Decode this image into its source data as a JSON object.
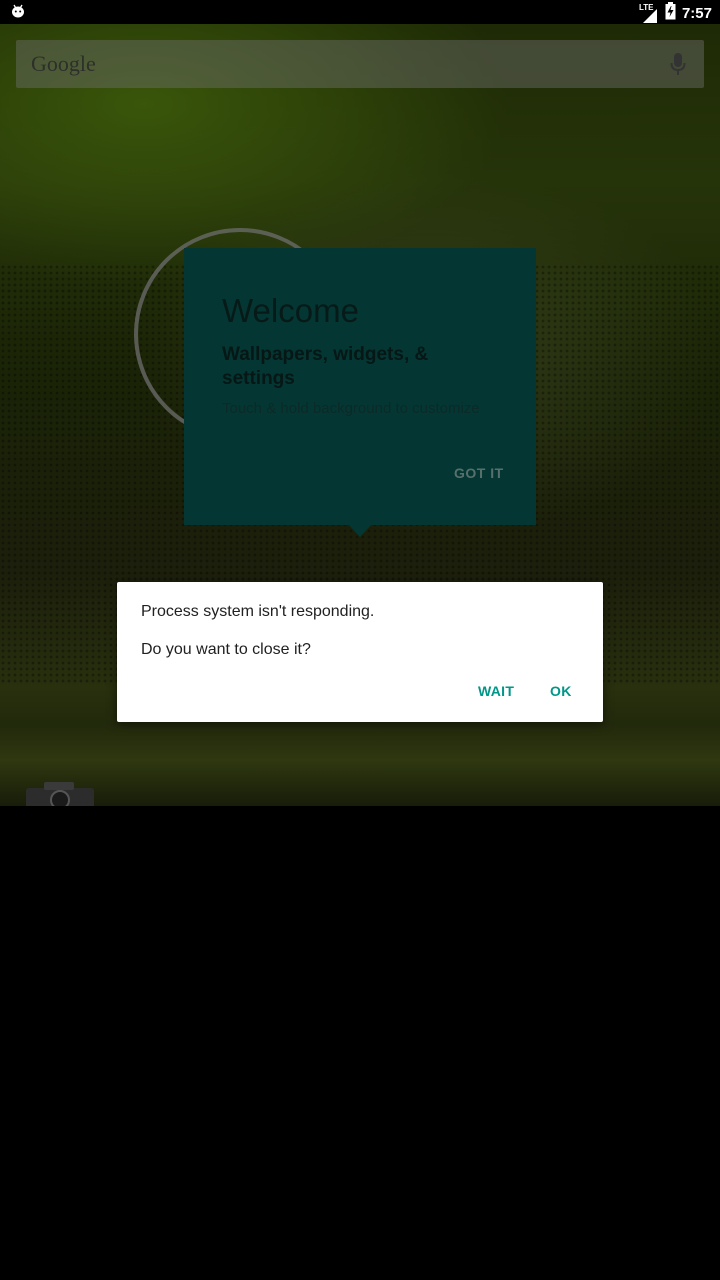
{
  "status_bar": {
    "time": "7:57",
    "network_label": "LTE",
    "icons": [
      "android-debug-icon",
      "signal-icon",
      "battery-charging-icon"
    ]
  },
  "search": {
    "logo_text": "Google",
    "icon": "mic-icon"
  },
  "welcome_card": {
    "title": "Welcome",
    "subtitle": "Wallpapers, widgets, & settings",
    "hint": "Touch & hold background to customize",
    "button_label": "GOT IT",
    "color": "#043733"
  },
  "dialog": {
    "message": "Process system isn't responding.",
    "question": "Do you want to close it?",
    "buttons": {
      "wait": "WAIT",
      "ok": "OK"
    },
    "accent_color": "#009688"
  },
  "dock": {
    "icon": "camera-icon"
  }
}
